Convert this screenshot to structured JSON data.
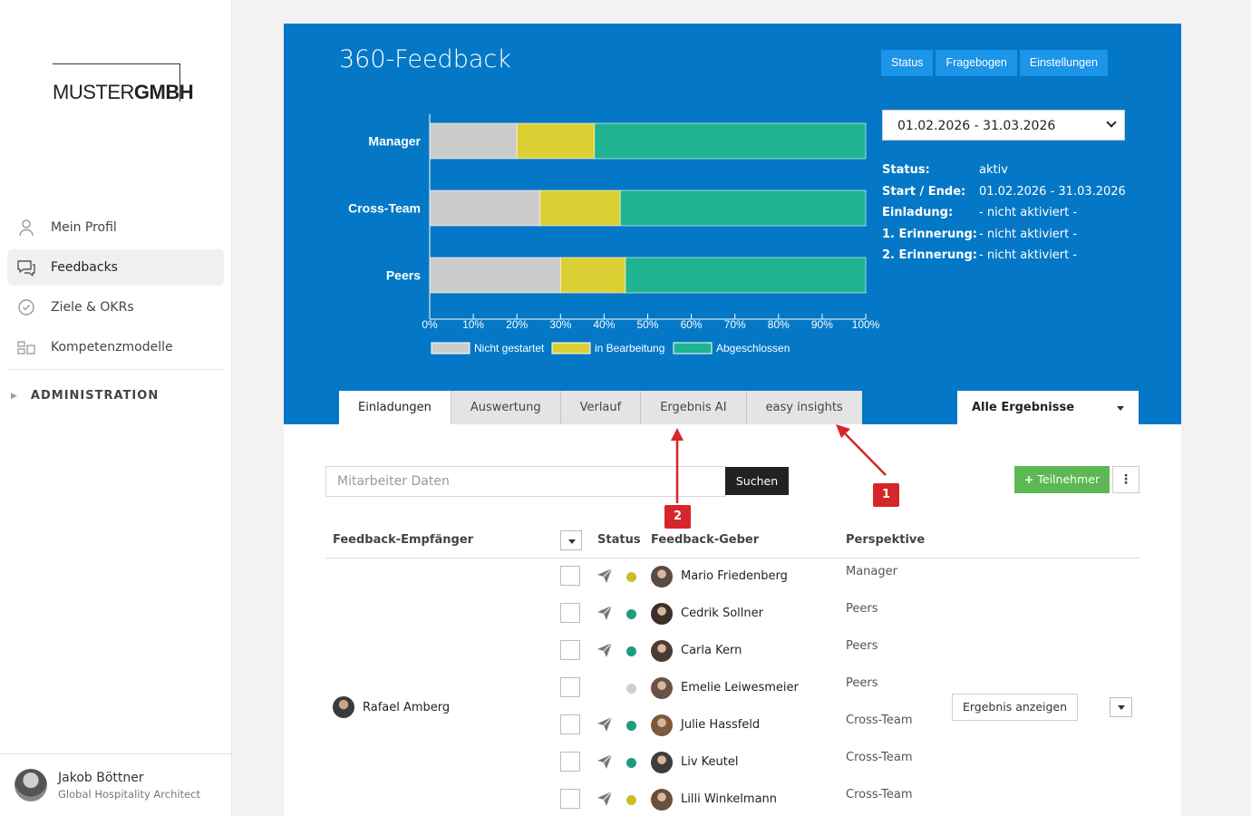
{
  "brand": {
    "logo_light": "MUSTER",
    "logo_bold": "GMBH"
  },
  "sidebar": {
    "items": [
      {
        "label": "Mein Profil",
        "icon": "user-icon",
        "active": false
      },
      {
        "label": "Feedbacks",
        "icon": "chat-icon",
        "active": true
      },
      {
        "label": "Ziele & OKRs",
        "icon": "check-circle-icon",
        "active": false
      },
      {
        "label": "Kompetenzmodelle",
        "icon": "grid-icon",
        "active": false
      }
    ],
    "admin_label": "ADMINISTRATION"
  },
  "user": {
    "name": "Jakob Böttner",
    "role": "Global Hospitality Architect"
  },
  "page": {
    "title": "360-Feedback",
    "buttons": {
      "status": "Status",
      "questionnaire": "Fragebogen",
      "settings": "Einstellungen"
    },
    "date_range_selected": "01.02.2026 - 31.03.2026",
    "info": [
      {
        "key": "Status:",
        "value": "aktiv"
      },
      {
        "key": "Start / Ende:",
        "value": "01.02.2026 - 31.03.2026"
      },
      {
        "key": "Einladung:",
        "value": "- nicht aktiviert -"
      },
      {
        "key": "1. Erinnerung:",
        "value": "- nicht aktiviert -"
      },
      {
        "key": "2. Erinnerung:",
        "value": "- nicht aktiviert -"
      }
    ],
    "tabs": [
      "Einladungen",
      "Auswertung",
      "Verlauf",
      "Ergebnis AI",
      "easy insights"
    ],
    "active_tab": "Einladungen",
    "filter_selected": "Alle Ergebnisse"
  },
  "chart_data": {
    "type": "bar",
    "orientation": "horizontal",
    "stacked": true,
    "categories": [
      "Manager",
      "Cross-Team",
      "Peers"
    ],
    "series": [
      {
        "name": "Nicht gestartet",
        "color": "#cccccc",
        "values": [
          20,
          25.3,
          30
        ]
      },
      {
        "name": "in Bearbeitung",
        "color": "#dccf33",
        "values": [
          17.8,
          18.4,
          14.9
        ]
      },
      {
        "name": "Abgeschlossen",
        "color": "#1fb392",
        "values": [
          62.2,
          56.3,
          55.1
        ]
      }
    ],
    "xlim": [
      0,
      100
    ],
    "xticks": [
      "0%",
      "10%",
      "20%",
      "30%",
      "40%",
      "50%",
      "60%",
      "70%",
      "80%",
      "90%",
      "100%"
    ],
    "legend": "bottom"
  },
  "search": {
    "placeholder": "Mitarbeiter Daten",
    "button": "Suchen"
  },
  "actions": {
    "add_participant": "Teilnehmer",
    "show_result": "Ergebnis anzeigen"
  },
  "table": {
    "headers": {
      "recipient": "Feedback-Empfänger",
      "status": "Status",
      "giver": "Feedback-Geber",
      "perspective": "Perspektive"
    },
    "recipient": "Rafael Amberg",
    "rows": [
      {
        "name": "Mario Friedenberg",
        "perspective": "Manager",
        "status_color": "#c9bd2a",
        "sent": true
      },
      {
        "name": "Cedrik Sollner",
        "perspective": "Peers",
        "status_color": "#1f9c80",
        "sent": true
      },
      {
        "name": "Carla Kern",
        "perspective": "Peers",
        "status_color": "#1f9c80",
        "sent": true
      },
      {
        "name": "Emelie Leiwesmeier",
        "perspective": "Peers",
        "status_color": "#cfcfcf",
        "sent": false
      },
      {
        "name": "Julie Hassfeld",
        "perspective": "Cross-Team",
        "status_color": "#1f9c80",
        "sent": true
      },
      {
        "name": "Liv Keutel",
        "perspective": "Cross-Team",
        "status_color": "#1f9c80",
        "sent": true
      },
      {
        "name": "Lilli Winkelmann",
        "perspective": "Cross-Team",
        "status_color": "#c9bd2a",
        "sent": true
      }
    ]
  },
  "annotations": {
    "marker_1": "1",
    "marker_2": "2"
  },
  "colors": {
    "hero": "#0478c6",
    "button_blue": "#1c94e8",
    "add_green": "#5cb852",
    "marker_red": "#d6262b"
  }
}
